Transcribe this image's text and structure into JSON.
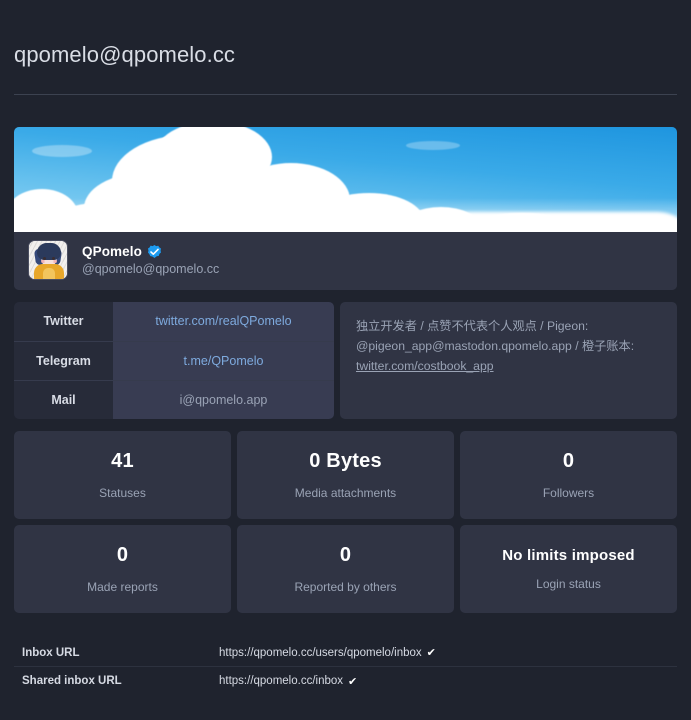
{
  "page": {
    "title": "qpomelo@qpomelo.cc"
  },
  "profile": {
    "banner_icon": "sky-clouds-banner",
    "avatar_icon": "user-avatar",
    "display_name": "QPomelo",
    "verified_icon": "verified-badge-icon",
    "handle": "@qpomelo@qpomelo.cc"
  },
  "links_table": {
    "rows": [
      {
        "label": "Twitter",
        "value": "twitter.com/realQPomelo",
        "is_link": true
      },
      {
        "label": "Telegram",
        "value": "t.me/QPomelo",
        "is_link": true
      },
      {
        "label": "Mail",
        "value": "i@qpomelo.app",
        "is_link": false
      }
    ]
  },
  "bio": {
    "text_before_link": "独立开发者 / 点赞不代表个人观点 / Pigeon: @pigeon_app@mastodon.qpomelo.app / 橙子账本: ",
    "link_text": "twitter.com/costbook_app"
  },
  "stats": [
    {
      "value": "41",
      "label": "Statuses",
      "size": "large"
    },
    {
      "value": "0 Bytes",
      "label": "Media attachments",
      "size": "large"
    },
    {
      "value": "0",
      "label": "Followers",
      "size": "large"
    },
    {
      "value": "0",
      "label": "Made reports",
      "size": "large"
    },
    {
      "value": "0",
      "label": "Reported by others",
      "size": "large"
    },
    {
      "value": "No limits imposed",
      "label": "Login status",
      "size": "small"
    }
  ],
  "urls": [
    {
      "label": "Inbox URL",
      "value": "https://qpomelo.cc/users/qpomelo/inbox",
      "check": "✔"
    },
    {
      "label": "Shared inbox URL",
      "value": "https://qpomelo.cc/inbox",
      "check": "✔"
    }
  ],
  "colors": {
    "background": "#1f232e",
    "card": "#303444",
    "table_label": "#272b39",
    "table_value": "#383c52",
    "link": "#7eaade",
    "verified": "#1d9bf0",
    "text_primary": "#ffffff",
    "text_muted": "#9aa3b5"
  }
}
